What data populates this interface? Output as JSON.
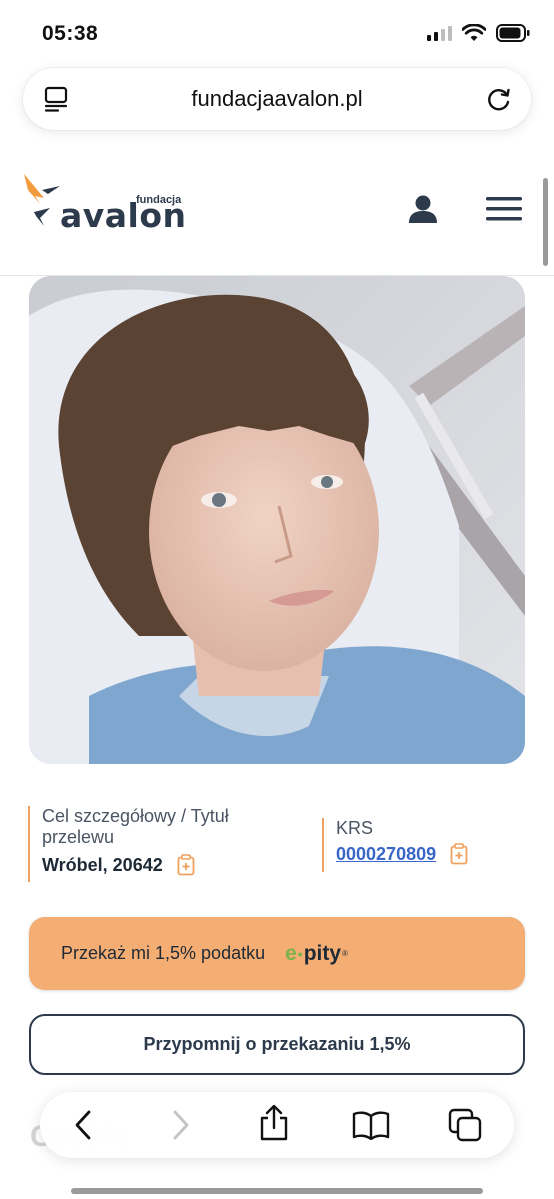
{
  "status_bar": {
    "time": "05:38",
    "signal_bars": 2,
    "battery_level": 0.85
  },
  "browser": {
    "url": "fundacjaavalon.pl"
  },
  "site": {
    "logo_small": "fundacja",
    "logo_main": "avalon"
  },
  "info": {
    "target_label": "Cel szczegółowy / Tytuł przelewu",
    "target_value": "Wróbel, 20642",
    "krs_label": "KRS",
    "krs_value": "0000270809"
  },
  "buttons": {
    "tax_label": "Przekaż mi 1,5% podatku",
    "epity_e": "e",
    "epity_rest": "pity",
    "epity_mark": "®",
    "remind_label": "Przypomnij o przekazaniu 1,5%"
  },
  "background_text": "Cookie",
  "colors": {
    "accent_orange": "#f4ad72",
    "border_orange": "#f0a15f",
    "navy": "#2c3a4b",
    "link_blue": "#3a66c8",
    "epity_green": "#7bb44b"
  },
  "icons": [
    "reader-icon",
    "reload-icon",
    "user-icon",
    "hamburger-menu-icon",
    "copy-icon",
    "back-icon",
    "forward-icon",
    "share-icon",
    "bookmarks-icon",
    "tabs-icon"
  ]
}
